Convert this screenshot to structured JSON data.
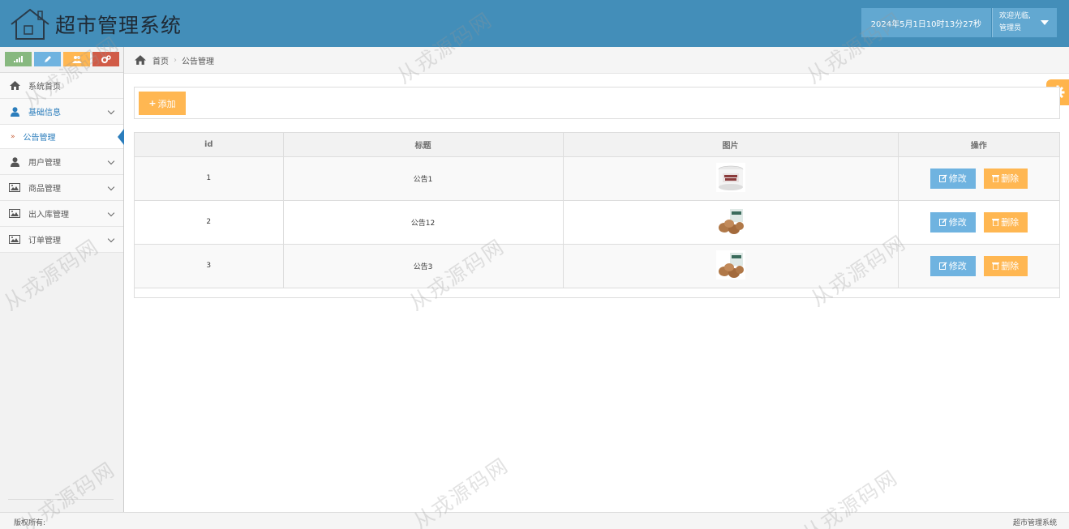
{
  "header": {
    "title": "超市管理系统",
    "datetime": "2024年5月1日10时13分27秒",
    "welcome": "欢迎光临,",
    "role": "管理员"
  },
  "sidebar": {
    "items": [
      {
        "label": "系统首页",
        "icon": "home-icon"
      },
      {
        "label": "基础信息",
        "icon": "user-icon",
        "open": true
      },
      {
        "label": "用户管理",
        "icon": "user-icon"
      },
      {
        "label": "商品管理",
        "icon": "picture-icon"
      },
      {
        "label": "出入库管理",
        "icon": "picture-icon"
      },
      {
        "label": "订单管理",
        "icon": "picture-icon"
      }
    ],
    "sub_item": "公告管理"
  },
  "breadcrumb": {
    "home": "首页",
    "current": "公告管理"
  },
  "toolbar": {
    "add_label": "添加"
  },
  "table": {
    "headers": [
      "id",
      "标题",
      "图片",
      "操作"
    ],
    "rows": [
      {
        "id": "1",
        "title": "公告1",
        "image": "product-can-image"
      },
      {
        "id": "2",
        "title": "公告12",
        "image": "product-nuts-image"
      },
      {
        "id": "3",
        "title": "公告3",
        "image": "product-nuts-image"
      }
    ],
    "edit_label": "修改",
    "delete_label": "删除"
  },
  "footer": {
    "left": "版权所有:",
    "right": "超市管理系统"
  },
  "watermark": "从戎源码网",
  "colors": {
    "header": "#438eb9",
    "accent_blue": "#6fb3e0",
    "accent_orange": "#ffb752",
    "accent_green": "#87b87f",
    "accent_red": "#d15b47"
  }
}
